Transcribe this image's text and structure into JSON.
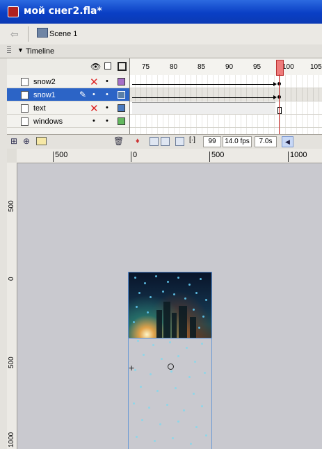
{
  "window": {
    "title": "мой снег2.fla*"
  },
  "scene_bar": {
    "scene_label": "Scene 1"
  },
  "timeline": {
    "panel_label": "Timeline",
    "frame_numbers": [
      "75",
      "80",
      "85",
      "90",
      "95",
      "100",
      "105"
    ],
    "layers": [
      {
        "name": "snow2",
        "hidden_mark": "✕",
        "lock_dot": "•",
        "color": "#a66fc7",
        "selected": false
      },
      {
        "name": "snow1",
        "hidden_mark": "•",
        "lock_dot": "•",
        "color": "#5b7fa8",
        "selected": true
      },
      {
        "name": "text",
        "hidden_mark": "✕",
        "lock_dot": "•",
        "color": "#4b7bc1",
        "selected": false
      },
      {
        "name": "windows",
        "hidden_mark": "•",
        "lock_dot": "•",
        "color": "#63b85f",
        "selected": false
      }
    ],
    "status": {
      "current_frame": "99",
      "frame_rate": "14.0 fps",
      "elapsed": "7.0s"
    }
  },
  "stage": {
    "h_ruler_ticks": [
      "500",
      "0",
      "500",
      "1000"
    ],
    "v_ruler_ticks": [
      "500",
      "0",
      "500",
      "1000"
    ]
  },
  "colors": {
    "selection": "#2c64c6",
    "playhead": "#ee7b7b",
    "title_bar": "#0a3fc5"
  }
}
